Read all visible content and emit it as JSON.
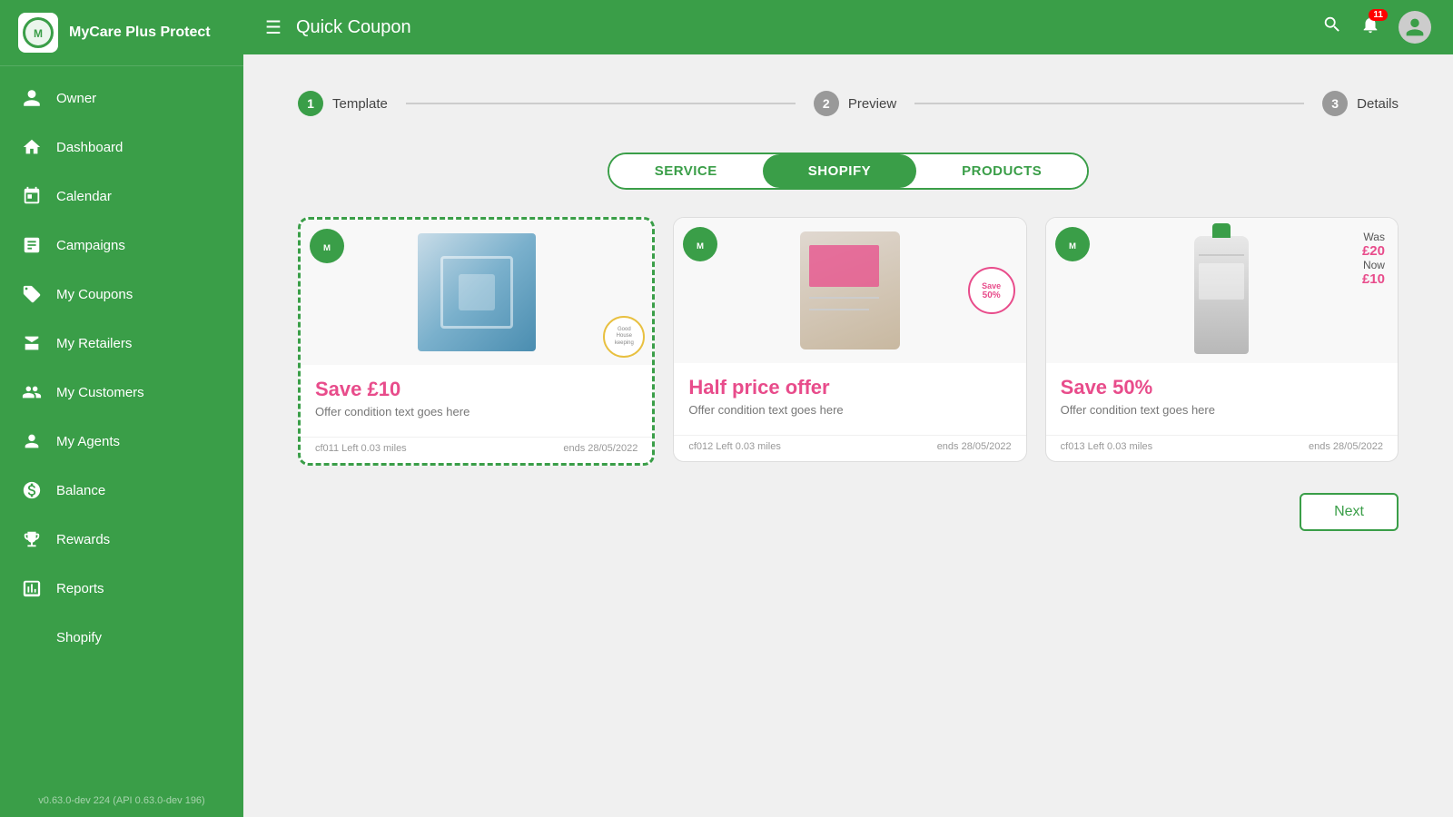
{
  "app": {
    "title": "MyCare Plus Protect",
    "version": "v0.63.0-dev 224 (API 0.63.0-dev 196)"
  },
  "header": {
    "menu_icon": "☰",
    "page_title": "Quick Coupon",
    "notification_count": "11"
  },
  "sidebar": {
    "items": [
      {
        "id": "owner",
        "label": "Owner",
        "icon": "person"
      },
      {
        "id": "dashboard",
        "label": "Dashboard",
        "icon": "home"
      },
      {
        "id": "calendar",
        "label": "Calendar",
        "icon": "calendar"
      },
      {
        "id": "campaigns",
        "label": "Campaigns",
        "icon": "chart"
      },
      {
        "id": "my-coupons",
        "label": "My Coupons",
        "icon": "tag"
      },
      {
        "id": "my-retailers",
        "label": "My Retailers",
        "icon": "store"
      },
      {
        "id": "my-customers",
        "label": "My Customers",
        "icon": "people"
      },
      {
        "id": "my-agents",
        "label": "My Agents",
        "icon": "group"
      },
      {
        "id": "balance",
        "label": "Balance",
        "icon": "balance"
      },
      {
        "id": "rewards",
        "label": "Rewards",
        "icon": "trophy"
      },
      {
        "id": "reports",
        "label": "Reports",
        "icon": "reports"
      },
      {
        "id": "shopify",
        "label": "Shopify",
        "icon": "shopify"
      }
    ]
  },
  "stepper": {
    "steps": [
      {
        "number": "1",
        "label": "Template",
        "state": "active"
      },
      {
        "number": "2",
        "label": "Preview",
        "state": "inactive"
      },
      {
        "number": "3",
        "label": "Details",
        "state": "inactive"
      }
    ]
  },
  "tabs": {
    "items": [
      {
        "id": "service",
        "label": "SERVICE"
      },
      {
        "id": "shopify",
        "label": "SHOPIFY",
        "active": true
      },
      {
        "id": "products",
        "label": "PRODUCTS"
      }
    ]
  },
  "cards": [
    {
      "id": "card1",
      "selected": true,
      "offer_text": "Save £10",
      "condition": "Offer condition text goes here",
      "footer_left": "cf011 Left   0.03 miles",
      "footer_right": "ends 28/05/2022",
      "product_type": "box",
      "badge": "Good Housekeeping"
    },
    {
      "id": "card2",
      "selected": false,
      "offer_text": "Half price offer",
      "condition": "Offer condition text goes here",
      "footer_left": "cf012 Left   0.03 miles",
      "footer_right": "ends 28/05/2022",
      "product_type": "bag",
      "save_badge_line1": "Save",
      "save_badge_line2": "50%"
    },
    {
      "id": "card3",
      "selected": false,
      "offer_text": "Save 50%",
      "condition": "Offer condition text goes here",
      "footer_left": "cf013 Left   0.03 miles",
      "footer_right": "ends 28/05/2022",
      "product_type": "bottle",
      "was_label": "Was",
      "was_price": "£20",
      "now_label": "Now",
      "now_price": "£10"
    }
  ],
  "next_button": "Next"
}
